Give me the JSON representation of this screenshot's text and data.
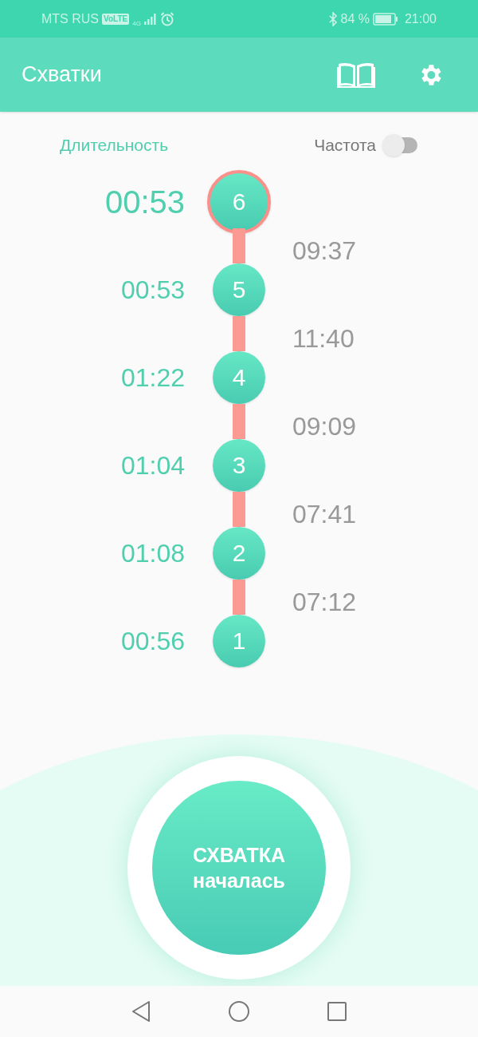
{
  "status_bar": {
    "carrier": "MTS RUS",
    "volte": "VoLTE",
    "network": "4G",
    "battery": "84 %",
    "time": "21:00"
  },
  "app_bar": {
    "title": "Схватки"
  },
  "header": {
    "duration_label": "Длительность",
    "frequency_label": "Частота",
    "frequency_on": false
  },
  "contractions": [
    {
      "number": "6",
      "duration": "00:53",
      "selected": true,
      "interval": "09:37"
    },
    {
      "number": "5",
      "duration": "00:53",
      "selected": false,
      "interval": "11:40"
    },
    {
      "number": "4",
      "duration": "01:22",
      "selected": false,
      "interval": "09:09"
    },
    {
      "number": "3",
      "duration": "01:04",
      "selected": false,
      "interval": "07:41"
    },
    {
      "number": "2",
      "duration": "01:08",
      "selected": false,
      "interval": "07:12"
    },
    {
      "number": "1",
      "duration": "00:56",
      "selected": false
    }
  ],
  "start_button": {
    "line_1": "СХВАТКА",
    "line_2": "началась"
  }
}
